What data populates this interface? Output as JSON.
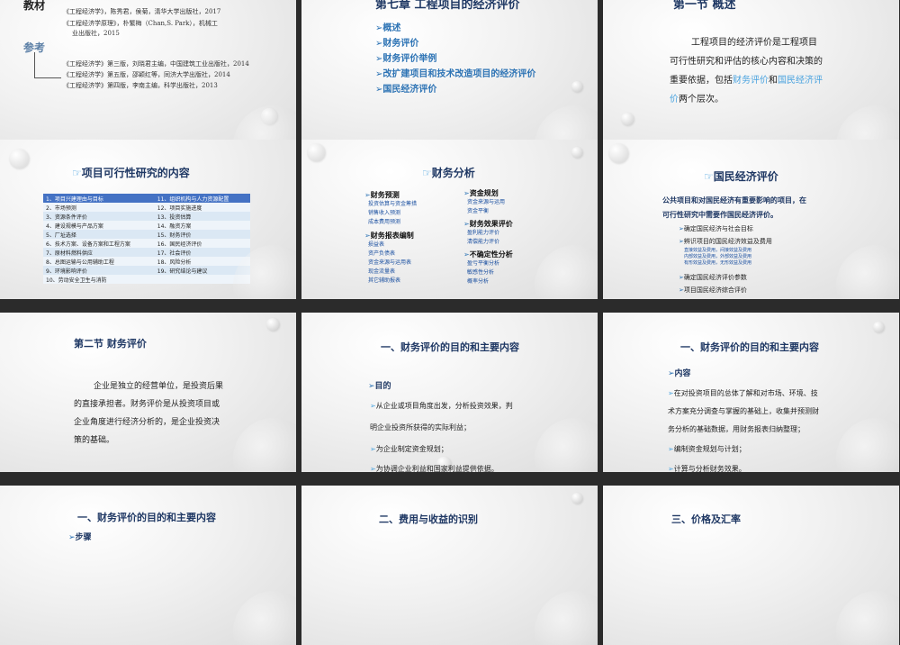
{
  "slide1": {
    "label_textbook": "教材",
    "label_reference": "参考",
    "textbooks": [
      "《工程经济学》，陈秀君，侯菊，清华大学出版社，2017",
      "《工程经济学原理》，朴繁梅（Chan,S. Park），机械工",
      "业出版社，2015"
    ],
    "references": [
      "《工程经济学》第三版，刘晓君主编，中国建筑工业出版社，2014",
      "《工程经济学》第五版，邵颖红等，同济大学出版社，2014",
      "《工程经济学》第四版，李南主编，科学出版社，2013"
    ]
  },
  "slide2": {
    "title": "第七章  工程项目的经济评价",
    "items": [
      "概述",
      "财务评价",
      "财务评价举例",
      "改扩建项目和技术改造项目的经济评价",
      "国民经济评价"
    ]
  },
  "slide3": {
    "title": "第一节  概述",
    "p1": "工程项目的经济评价是工程项目",
    "p2": "可行性研究和评估的核心内容和决策的",
    "p3a": "重要依据，包括",
    "p3b": "财务评价",
    "p3c": "和",
    "p3d": "国民经济评",
    "p4a": "价",
    "p4b": "两个层次。"
  },
  "slide4": {
    "title": "项目可行性研究的内容",
    "left": [
      "1、项目兴建理由与目标",
      "2、市场预测",
      "3、资源条件评价",
      "4、建设规模与产品方案",
      "5、厂址选择",
      "6、技术方案、设备方案和工程方案",
      "7、原材料燃料供应",
      "8、总图运输与公用辅助工程",
      "9、环境影响评价",
      "10、劳动安全卫生与消防"
    ],
    "right": [
      "11、组织机构与人力资源配置",
      "12、项目实施进度",
      "13、投资估算",
      "14、融资方案",
      "15、财务评价",
      "16、国民经济评价",
      "17、社会评价",
      "18、风险分析",
      "19、研究结论与建议",
      ""
    ]
  },
  "slide5": {
    "title": "财务分析",
    "g1": "财务预测",
    "g1items": [
      "投资估算与资金筹措",
      "销售收入预测",
      "成本费用预测"
    ],
    "g2": "财务报表编制",
    "g2items": [
      "损益表",
      "资产负债表",
      "资金来源与运用表",
      "现金流量表",
      "其它辅助报表"
    ],
    "g3": "资金规划",
    "g3items": [
      "资金来源与运用",
      "资金平衡"
    ],
    "g4": "财务效果评价",
    "g4items": [
      "盈利能力评价",
      "清偿能力评价"
    ],
    "g5": "不确定性分析",
    "g5items": [
      "盈亏平衡分析",
      "敏感性分析",
      "概率分析"
    ]
  },
  "slide6": {
    "title": "国民经济评价",
    "intro1": "公共项目和对国民经济有重要影响的项目，在",
    "intro2": "可行性研究中需要作国民经济评价。",
    "b1": "确定国民经济与社会目标",
    "b2": "辨识项目的国民经济效益及费用",
    "subs": [
      "直接效益及费用，间接效益及费用",
      "内部效益及费用，外部效益及费用",
      "有形效益及费用，无形效益及费用"
    ],
    "b3": "确定国民经济评价参数",
    "b4": "项目国民经济综合评价"
  },
  "slide7": {
    "title": "第二节  财务评价",
    "lines": [
      "企业是独立的经营单位，是投资后果",
      "的直接承担者。财务评价是从投资项目或",
      "企业角度进行经济分析的，是企业投资决",
      "策的基础。"
    ]
  },
  "slide8": {
    "title": "一、财务评价的目的和主要内容",
    "head": "目的",
    "lines": [
      "从企业或项目角度出发，分析投资效果，判",
      "明企业投资所获得的实际利益；",
      "为企业制定资金规划；",
      "为协调企业利益和国家利益提供依据。"
    ]
  },
  "slide9": {
    "title": "一、财务评价的目的和主要内容",
    "head": "内容",
    "lines": [
      "在对投资项目的总体了解和对市场、环境、技",
      "术方案充分调查与掌握的基础上，收集并预测财",
      "务分析的基础数据，用财务报表归纳整理；",
      "编制资金规划与计划；",
      "计算与分析财务效果。"
    ]
  },
  "slide10": {
    "title": "一、财务评价的目的和主要内容",
    "head": "步骤"
  },
  "slide11": {
    "title": "二、费用与收益的识别"
  },
  "slide12": {
    "title": "三、价格及汇率"
  },
  "colors": {
    "title": "#1f3864",
    "accent": "#2e74b5",
    "highlight": "#4aa3df",
    "table_header": "#4472c4"
  },
  "icons": {
    "bullet": "arrow-bullet-icon",
    "slide_icon": "list-icon"
  }
}
